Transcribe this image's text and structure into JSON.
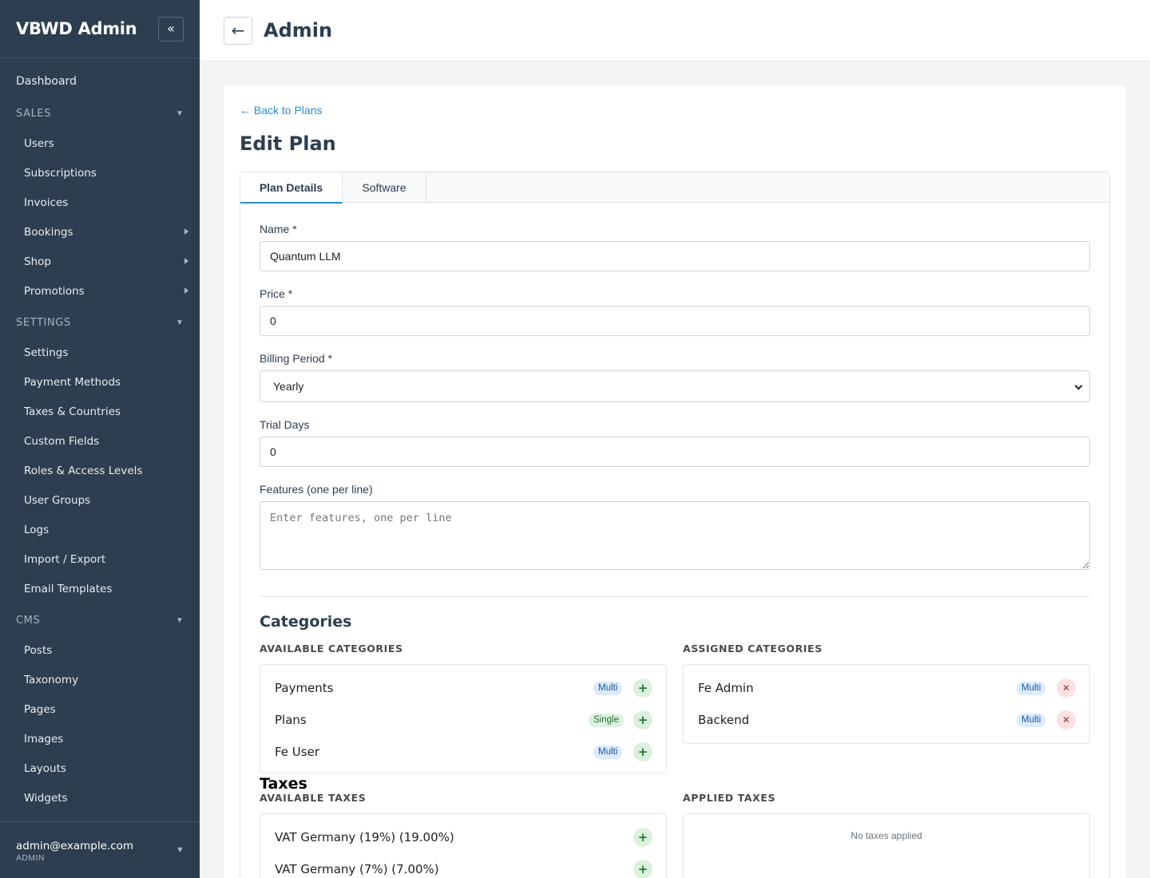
{
  "sidebar": {
    "brand": "VBWD Admin",
    "collapse_icon": "«",
    "dashboard": "Dashboard",
    "sales": {
      "label": "SALES",
      "items": [
        "Users",
        "Subscriptions",
        "Invoices",
        "Bookings",
        "Shop",
        "Promotions"
      ]
    },
    "settings": {
      "label": "SETTINGS",
      "items": [
        "Settings",
        "Payment Methods",
        "Taxes & Countries",
        "Custom Fields",
        "Roles & Access Levels",
        "User Groups",
        "Logs",
        "Import / Export",
        "Email Templates"
      ]
    },
    "cms": {
      "label": "CMS",
      "items": [
        "Posts",
        "Taxonomy",
        "Pages",
        "Images",
        "Layouts",
        "Widgets"
      ]
    },
    "user": {
      "email": "admin@example.com",
      "role": "ADMIN"
    }
  },
  "topbar": {
    "back_icon": "←",
    "title": "Admin"
  },
  "page": {
    "back_link": "← Back to Plans",
    "title": "Edit Plan",
    "tabs": [
      "Plan Details",
      "Software"
    ],
    "active_tab": "Plan Details"
  },
  "form": {
    "name": {
      "label": "Name *",
      "value": "Quantum LLM"
    },
    "price": {
      "label": "Price *",
      "value": "0"
    },
    "billing_period": {
      "label": "Billing Period *",
      "value": "Yearly"
    },
    "trial_days": {
      "label": "Trial Days",
      "value": "0"
    },
    "features": {
      "label": "Features (one per line)",
      "placeholder": "Enter features, one per line",
      "value": ""
    }
  },
  "categories": {
    "title": "Categories",
    "available_label": "AVAILABLE CATEGORIES",
    "assigned_label": "ASSIGNED CATEGORIES",
    "available": [
      {
        "name": "Payments",
        "type": "Multi"
      },
      {
        "name": "Plans",
        "type": "Single"
      },
      {
        "name": "Fe User",
        "type": "Multi"
      }
    ],
    "assigned": [
      {
        "name": "Fe Admin",
        "type": "Multi"
      },
      {
        "name": "Backend",
        "type": "Multi"
      }
    ]
  },
  "taxes": {
    "title": "Taxes",
    "available_label": "AVAILABLE TAXES",
    "applied_label": "APPLIED TAXES",
    "available": [
      {
        "name": "VAT Germany (19%) (19.00%)"
      },
      {
        "name": "VAT Germany (7%) (7.00%)"
      }
    ],
    "empty_text": "No taxes applied"
  },
  "colors": {
    "sidebar_bg": "#2c3e50",
    "accent": "#2a8bd6",
    "add": "#1f7a33",
    "remove": "#b92b2b"
  }
}
